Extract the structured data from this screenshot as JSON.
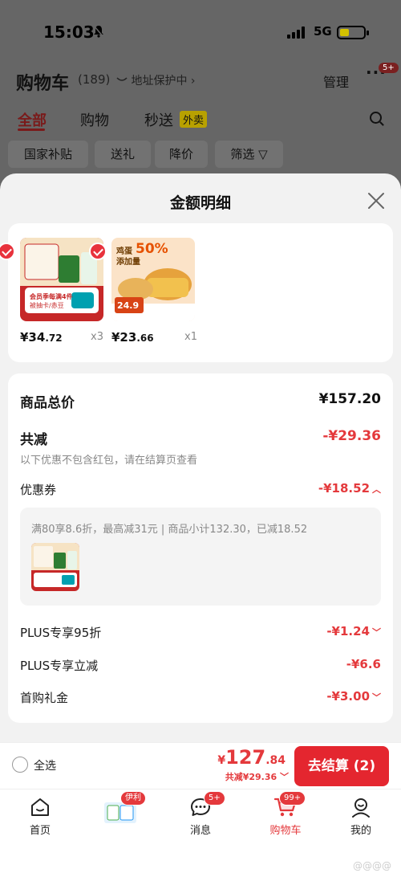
{
  "status_bar": {
    "time": "15:03",
    "network": "5G"
  },
  "header": {
    "title": "购物车",
    "count": "(189)",
    "address_label": "地址保护中",
    "manage": "管理",
    "more_badge": "5+"
  },
  "tabs": [
    {
      "label": "全部",
      "active": true
    },
    {
      "label": "购物",
      "active": false
    },
    {
      "label": "秒送",
      "active": false
    }
  ],
  "waimai_badge": "外卖",
  "filters": [
    "国家补贴",
    "送礼",
    "降价",
    "筛选"
  ],
  "sheet": {
    "title": "金额明细",
    "products": [
      {
        "price_int": "¥34",
        "price_dec": ".72",
        "qty": "x3",
        "image_text_1": "会员季每满4件",
        "image_text_2": "被抽卡/赤豆"
      },
      {
        "price_int": "¥23",
        "price_dec": ".66",
        "qty": "x1",
        "image_text_1": "鸡蛋",
        "image_text_2": "添加量",
        "image_text_3": "50%",
        "image_text_4": "24.9"
      }
    ],
    "summary": {
      "total_label": "商品总价",
      "total_value": "¥157.20",
      "reduce_label": "共减",
      "reduce_value": "-¥29.36",
      "note": "以下优惠不包含红包，请在结算页查看",
      "coupon_label": "优惠券",
      "coupon_value": "-¥18.52",
      "coupon_detail": "满80享8.6折，最高减31元 | 商品小计132.30，已减18.52",
      "plus95_label": "PLUS专享95折",
      "plus95_value": "-¥1.24",
      "plus_reduce_label": "PLUS专享立减",
      "plus_reduce_value": "-¥6.6",
      "first_gift_label": "首购礼金",
      "first_gift_value": "-¥3.00"
    }
  },
  "checkout": {
    "select_all": "全选",
    "symbol": "¥",
    "total_int": "127",
    "total_dec": ".84",
    "reduce_text": "共减¥29.36",
    "button": "去结算 (2)"
  },
  "tabbar": {
    "items": [
      {
        "label": "首页",
        "active": false
      },
      {
        "label": "",
        "badge": "伊利",
        "active": false
      },
      {
        "label": "消息",
        "badge": "5+",
        "active": false
      },
      {
        "label": "购物车",
        "badge": "99+",
        "active": true
      },
      {
        "label": "我的",
        "active": false
      }
    ],
    "watermark": "@@@@"
  },
  "colors": {
    "accent": "#e4393c",
    "button": "#e4262f"
  }
}
